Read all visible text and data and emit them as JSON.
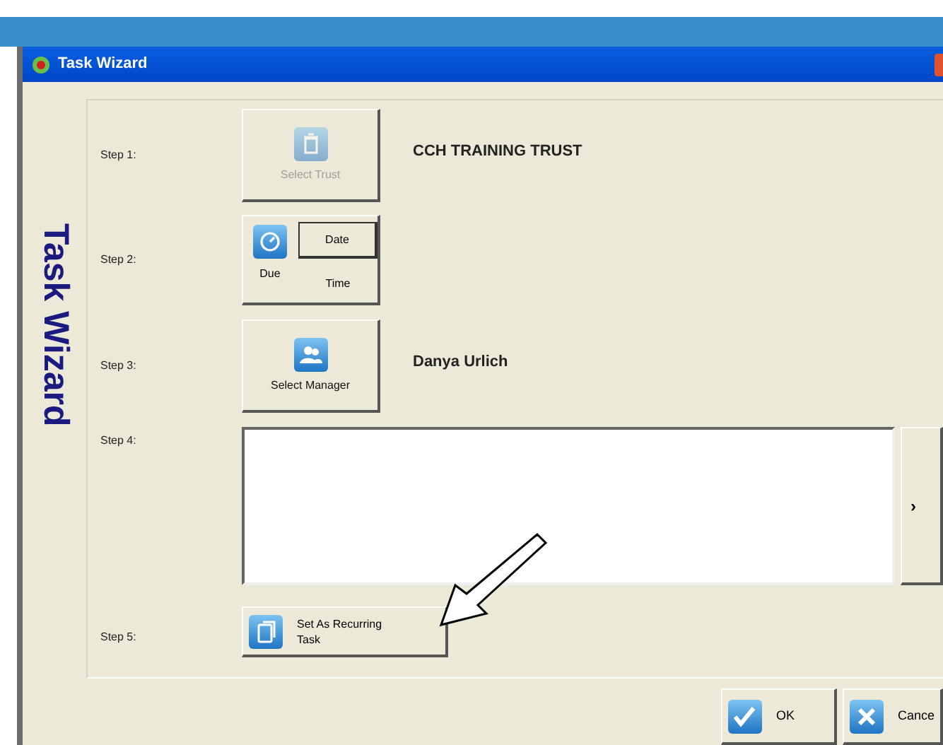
{
  "window": {
    "title": "Task Wizard"
  },
  "side_title": "Task Wizard",
  "steps": [
    {
      "kind": "button",
      "label": "Step 1:",
      "button": "Select Trust",
      "disabled": true,
      "value": "CCH TRAINING TRUST"
    },
    {
      "kind": "due",
      "label": "Step 2:",
      "due": "Due",
      "options": [
        {
          "label": "Date",
          "selected": true
        },
        {
          "label": "Time",
          "selected": false
        }
      ]
    },
    {
      "kind": "button",
      "label": "Step 3:",
      "button": "Select Manager",
      "disabled": false,
      "value": "Danya Urlich"
    },
    {
      "kind": "notes",
      "label": "Step 4:",
      "side_button": "›"
    },
    {
      "kind": "recurring",
      "label": "Step 5:",
      "button": "Set As Recurring Task"
    }
  ],
  "buttons": [
    {
      "kind": "ok",
      "label": "OK"
    },
    {
      "kind": "cancel",
      "label": "Cance"
    }
  ]
}
